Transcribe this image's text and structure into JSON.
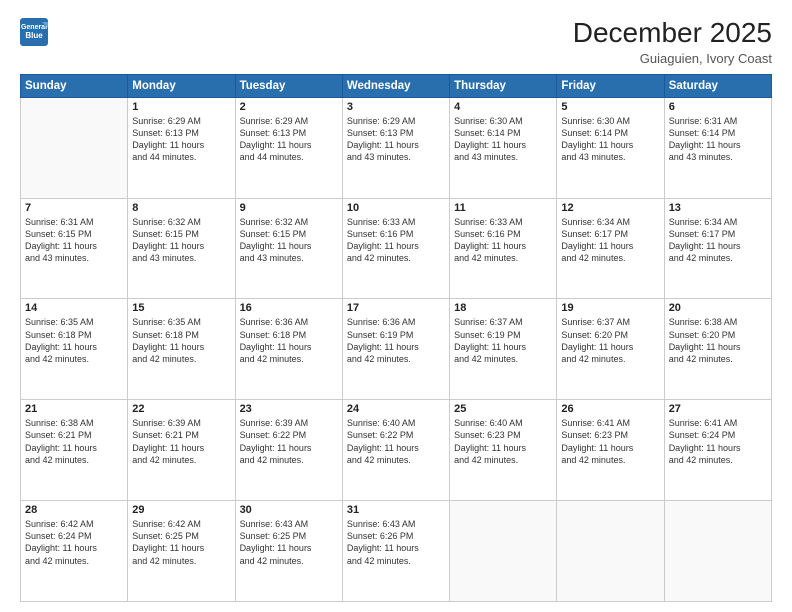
{
  "header": {
    "logo_general": "General",
    "logo_blue": "Blue",
    "month_year": "December 2025",
    "location": "Guiaguien, Ivory Coast"
  },
  "days_of_week": [
    "Sunday",
    "Monday",
    "Tuesday",
    "Wednesday",
    "Thursday",
    "Friday",
    "Saturday"
  ],
  "weeks": [
    [
      {
        "day": "",
        "info": ""
      },
      {
        "day": "1",
        "info": "Sunrise: 6:29 AM\nSunset: 6:13 PM\nDaylight: 11 hours\nand 44 minutes."
      },
      {
        "day": "2",
        "info": "Sunrise: 6:29 AM\nSunset: 6:13 PM\nDaylight: 11 hours\nand 44 minutes."
      },
      {
        "day": "3",
        "info": "Sunrise: 6:29 AM\nSunset: 6:13 PM\nDaylight: 11 hours\nand 43 minutes."
      },
      {
        "day": "4",
        "info": "Sunrise: 6:30 AM\nSunset: 6:14 PM\nDaylight: 11 hours\nand 43 minutes."
      },
      {
        "day": "5",
        "info": "Sunrise: 6:30 AM\nSunset: 6:14 PM\nDaylight: 11 hours\nand 43 minutes."
      },
      {
        "day": "6",
        "info": "Sunrise: 6:31 AM\nSunset: 6:14 PM\nDaylight: 11 hours\nand 43 minutes."
      }
    ],
    [
      {
        "day": "7",
        "info": "Sunrise: 6:31 AM\nSunset: 6:15 PM\nDaylight: 11 hours\nand 43 minutes."
      },
      {
        "day": "8",
        "info": "Sunrise: 6:32 AM\nSunset: 6:15 PM\nDaylight: 11 hours\nand 43 minutes."
      },
      {
        "day": "9",
        "info": "Sunrise: 6:32 AM\nSunset: 6:15 PM\nDaylight: 11 hours\nand 43 minutes."
      },
      {
        "day": "10",
        "info": "Sunrise: 6:33 AM\nSunset: 6:16 PM\nDaylight: 11 hours\nand 42 minutes."
      },
      {
        "day": "11",
        "info": "Sunrise: 6:33 AM\nSunset: 6:16 PM\nDaylight: 11 hours\nand 42 minutes."
      },
      {
        "day": "12",
        "info": "Sunrise: 6:34 AM\nSunset: 6:17 PM\nDaylight: 11 hours\nand 42 minutes."
      },
      {
        "day": "13",
        "info": "Sunrise: 6:34 AM\nSunset: 6:17 PM\nDaylight: 11 hours\nand 42 minutes."
      }
    ],
    [
      {
        "day": "14",
        "info": "Sunrise: 6:35 AM\nSunset: 6:18 PM\nDaylight: 11 hours\nand 42 minutes."
      },
      {
        "day": "15",
        "info": "Sunrise: 6:35 AM\nSunset: 6:18 PM\nDaylight: 11 hours\nand 42 minutes."
      },
      {
        "day": "16",
        "info": "Sunrise: 6:36 AM\nSunset: 6:18 PM\nDaylight: 11 hours\nand 42 minutes."
      },
      {
        "day": "17",
        "info": "Sunrise: 6:36 AM\nSunset: 6:19 PM\nDaylight: 11 hours\nand 42 minutes."
      },
      {
        "day": "18",
        "info": "Sunrise: 6:37 AM\nSunset: 6:19 PM\nDaylight: 11 hours\nand 42 minutes."
      },
      {
        "day": "19",
        "info": "Sunrise: 6:37 AM\nSunset: 6:20 PM\nDaylight: 11 hours\nand 42 minutes."
      },
      {
        "day": "20",
        "info": "Sunrise: 6:38 AM\nSunset: 6:20 PM\nDaylight: 11 hours\nand 42 minutes."
      }
    ],
    [
      {
        "day": "21",
        "info": "Sunrise: 6:38 AM\nSunset: 6:21 PM\nDaylight: 11 hours\nand 42 minutes."
      },
      {
        "day": "22",
        "info": "Sunrise: 6:39 AM\nSunset: 6:21 PM\nDaylight: 11 hours\nand 42 minutes."
      },
      {
        "day": "23",
        "info": "Sunrise: 6:39 AM\nSunset: 6:22 PM\nDaylight: 11 hours\nand 42 minutes."
      },
      {
        "day": "24",
        "info": "Sunrise: 6:40 AM\nSunset: 6:22 PM\nDaylight: 11 hours\nand 42 minutes."
      },
      {
        "day": "25",
        "info": "Sunrise: 6:40 AM\nSunset: 6:23 PM\nDaylight: 11 hours\nand 42 minutes."
      },
      {
        "day": "26",
        "info": "Sunrise: 6:41 AM\nSunset: 6:23 PM\nDaylight: 11 hours\nand 42 minutes."
      },
      {
        "day": "27",
        "info": "Sunrise: 6:41 AM\nSunset: 6:24 PM\nDaylight: 11 hours\nand 42 minutes."
      }
    ],
    [
      {
        "day": "28",
        "info": "Sunrise: 6:42 AM\nSunset: 6:24 PM\nDaylight: 11 hours\nand 42 minutes."
      },
      {
        "day": "29",
        "info": "Sunrise: 6:42 AM\nSunset: 6:25 PM\nDaylight: 11 hours\nand 42 minutes."
      },
      {
        "day": "30",
        "info": "Sunrise: 6:43 AM\nSunset: 6:25 PM\nDaylight: 11 hours\nand 42 minutes."
      },
      {
        "day": "31",
        "info": "Sunrise: 6:43 AM\nSunset: 6:26 PM\nDaylight: 11 hours\nand 42 minutes."
      },
      {
        "day": "",
        "info": ""
      },
      {
        "day": "",
        "info": ""
      },
      {
        "day": "",
        "info": ""
      }
    ]
  ]
}
